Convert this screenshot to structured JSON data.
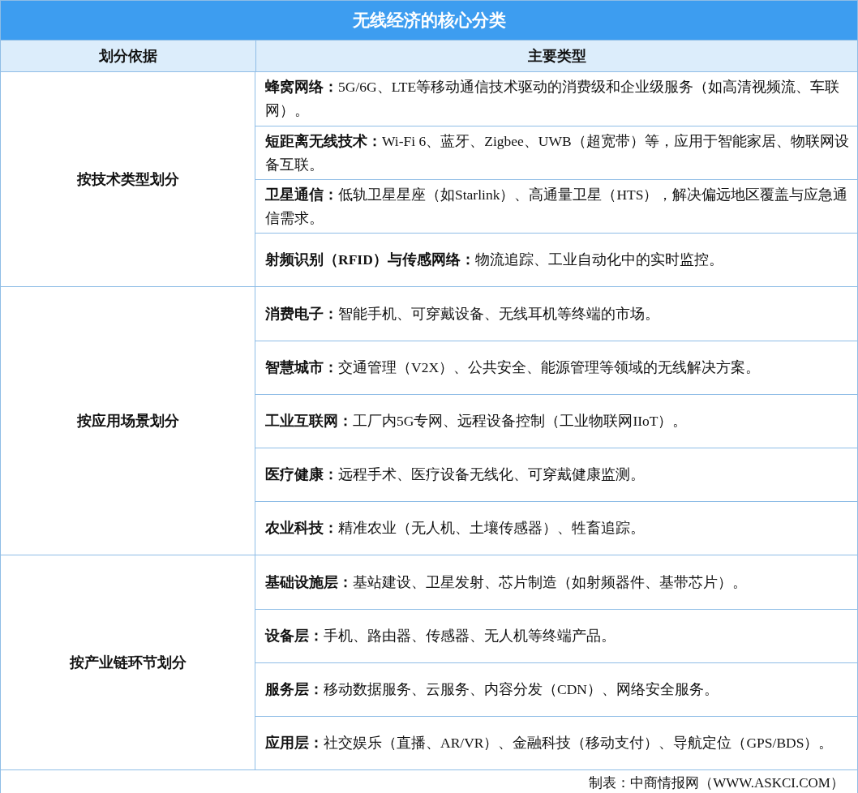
{
  "title": "无线经济的核心分类",
  "columns": [
    "划分依据",
    "主要类型"
  ],
  "groups": [
    {
      "basis": "按技术类型划分",
      "types": [
        "**蜂窝网络：**5G/6G、LTE等移动通信技术驱动的消费级和企业级服务（如高清视频流、车联网）。",
        "**短距离无线技术：**Wi-Fi 6、蓝牙、Zigbee、UWB（超宽带）等，应用于智能家居、物联网设备互联。",
        "**卫星通信：**低轨卫星星座（如Starlink）、高通量卫星（HTS），解决偏远地区覆盖与应急通信需求。",
        "**射频识别（RFID）与传感网络：**物流追踪、工业自动化中的实时监控。"
      ]
    },
    {
      "basis": "按应用场景划分",
      "types": [
        "**消费电子：**智能手机、可穿戴设备、无线耳机等终端的市场。",
        "**智慧城市：**交通管理（V2X）、公共安全、能源管理等领域的无线解决方案。",
        "**工业互联网：**工厂内5G专网、远程设备控制（工业物联网IIoT）。",
        "**医疗健康：**远程手术、医疗设备无线化、可穿戴健康监测。",
        "**农业科技：**精准农业（无人机、土壤传感器）、牲畜追踪。"
      ]
    },
    {
      "basis": "按产业链环节划分",
      "types": [
        "**基础设施层：**基站建设、卫星发射、芯片制造（如射频器件、基带芯片）。",
        "**设备层：**手机、路由器、传感器、无人机等终端产品。",
        "**服务层：**移动数据服务、云服务、内容分发（CDN）、网络安全服务。",
        "**应用层：**社交娱乐（直播、AR/VR）、金融科技（移动支付）、导航定位（GPS/BDS）。"
      ]
    }
  ],
  "source": "制表：中商情报网（WWW.ASKCI.COM）"
}
